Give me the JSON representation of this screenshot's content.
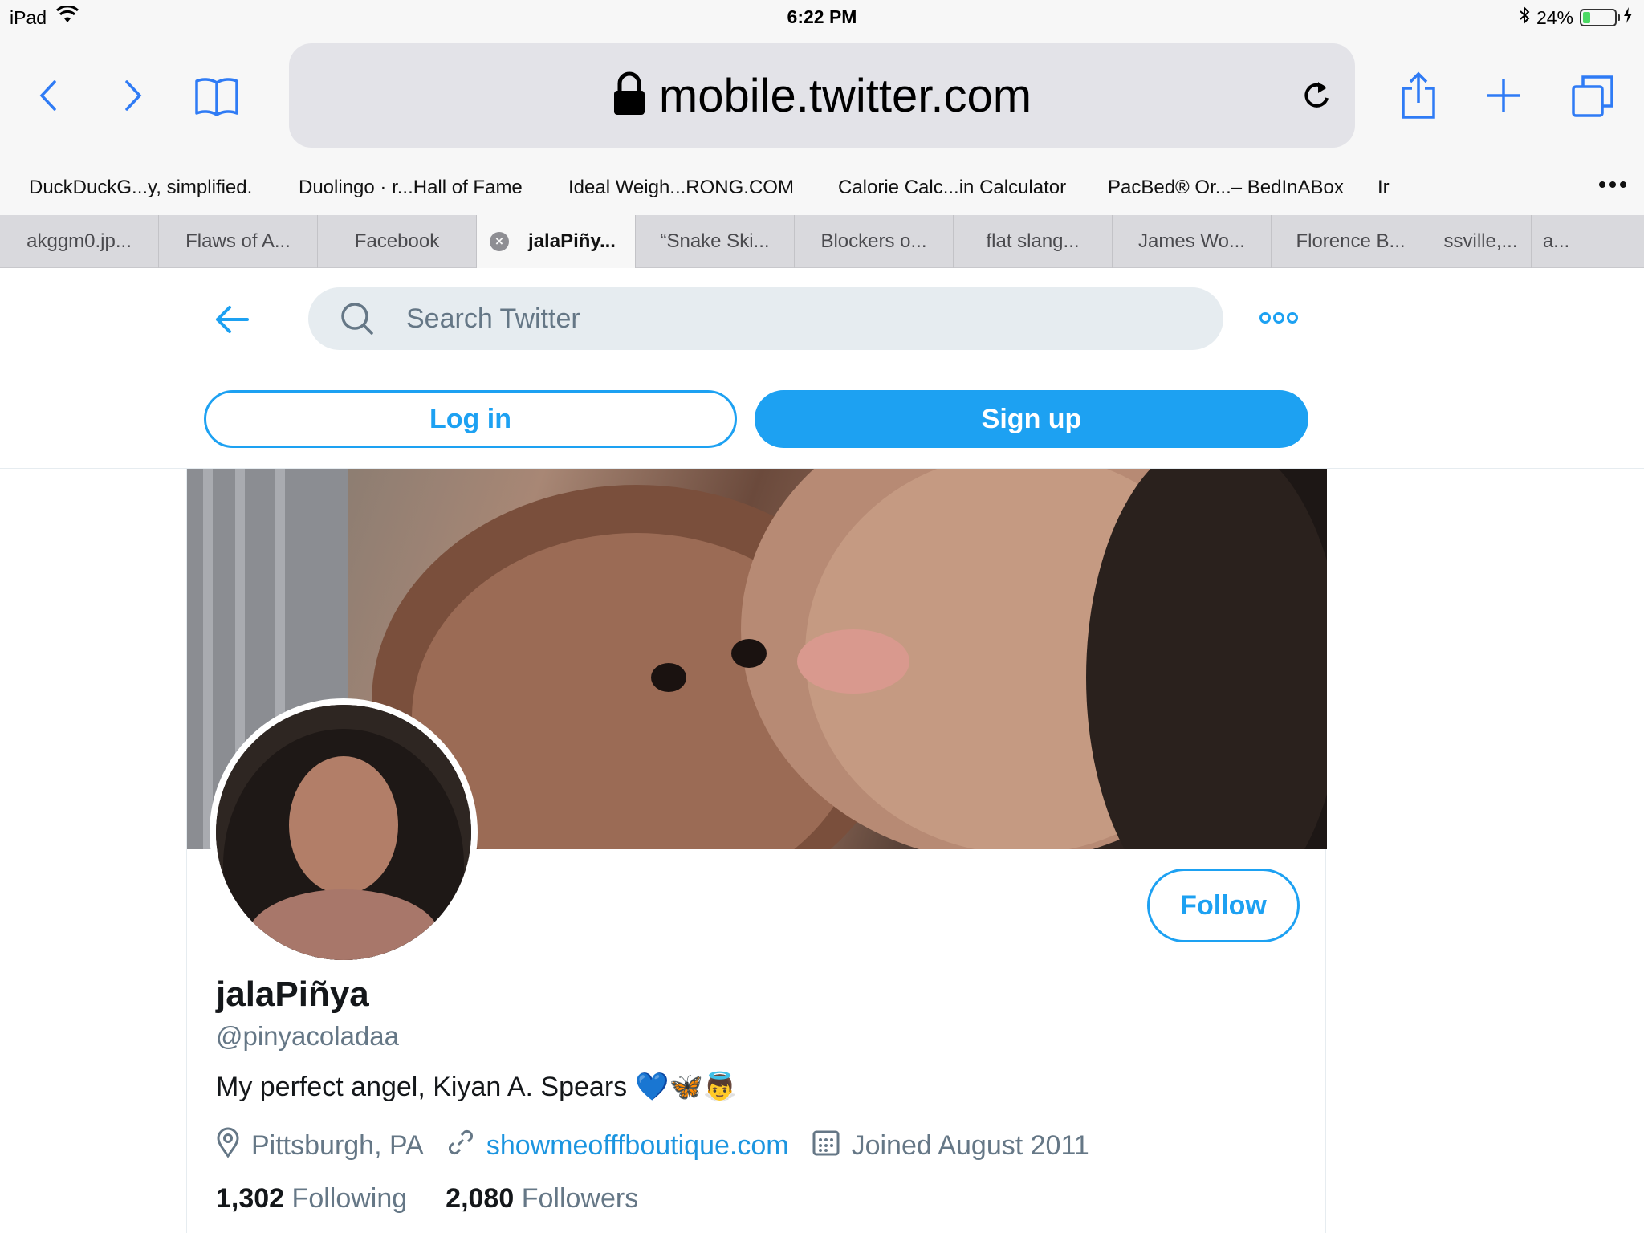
{
  "status_bar": {
    "device": "iPad",
    "time": "6:22 PM",
    "battery": "24%",
    "battery_level": 0.24
  },
  "browser": {
    "url": "mobile.twitter.com",
    "icons": [
      "back-icon",
      "forward-icon",
      "bookmarks-icon",
      "lock-icon",
      "reload-icon",
      "share-icon",
      "new-tab-icon",
      "tabs-icon"
    ]
  },
  "bookmarks": [
    "DuckDuckG...y, simplified.",
    "Duolingo · r...Hall of Fame",
    "Ideal Weigh...RONG.COM",
    "Calorie Calc...in Calculator",
    "PacBed® Or...– BedInABox",
    "Ir"
  ],
  "tabs": [
    "akggm0.jp...",
    "Flaws of A...",
    "Facebook",
    "jalaPiñy...",
    "“Snake Ski...",
    "Blockers o...",
    "flat slang...",
    "James Wo...",
    "Florence B...",
    "ssville,...",
    "a..."
  ],
  "twitter": {
    "search_placeholder": "Search Twitter",
    "login_label": "Log in",
    "signup_label": "Sign up",
    "follow_label": "Follow",
    "profile": {
      "name": "jalaPiñya",
      "handle": "@pinyacoladaa",
      "bio": "My perfect angel, Kiyan A. Spears",
      "bio_emoji": "💙🦋👼",
      "location": "Pittsburgh, PA",
      "website": "showmeofffboutique.com",
      "joined": "Joined August 2011",
      "following_count": "1,302",
      "following_label": "Following",
      "followers_count": "2,080",
      "followers_label": "Followers"
    }
  },
  "colors": {
    "twitter_blue": "#1da1f2",
    "safari_blue": "#2f7bf5",
    "secondary_text": "#657786"
  }
}
